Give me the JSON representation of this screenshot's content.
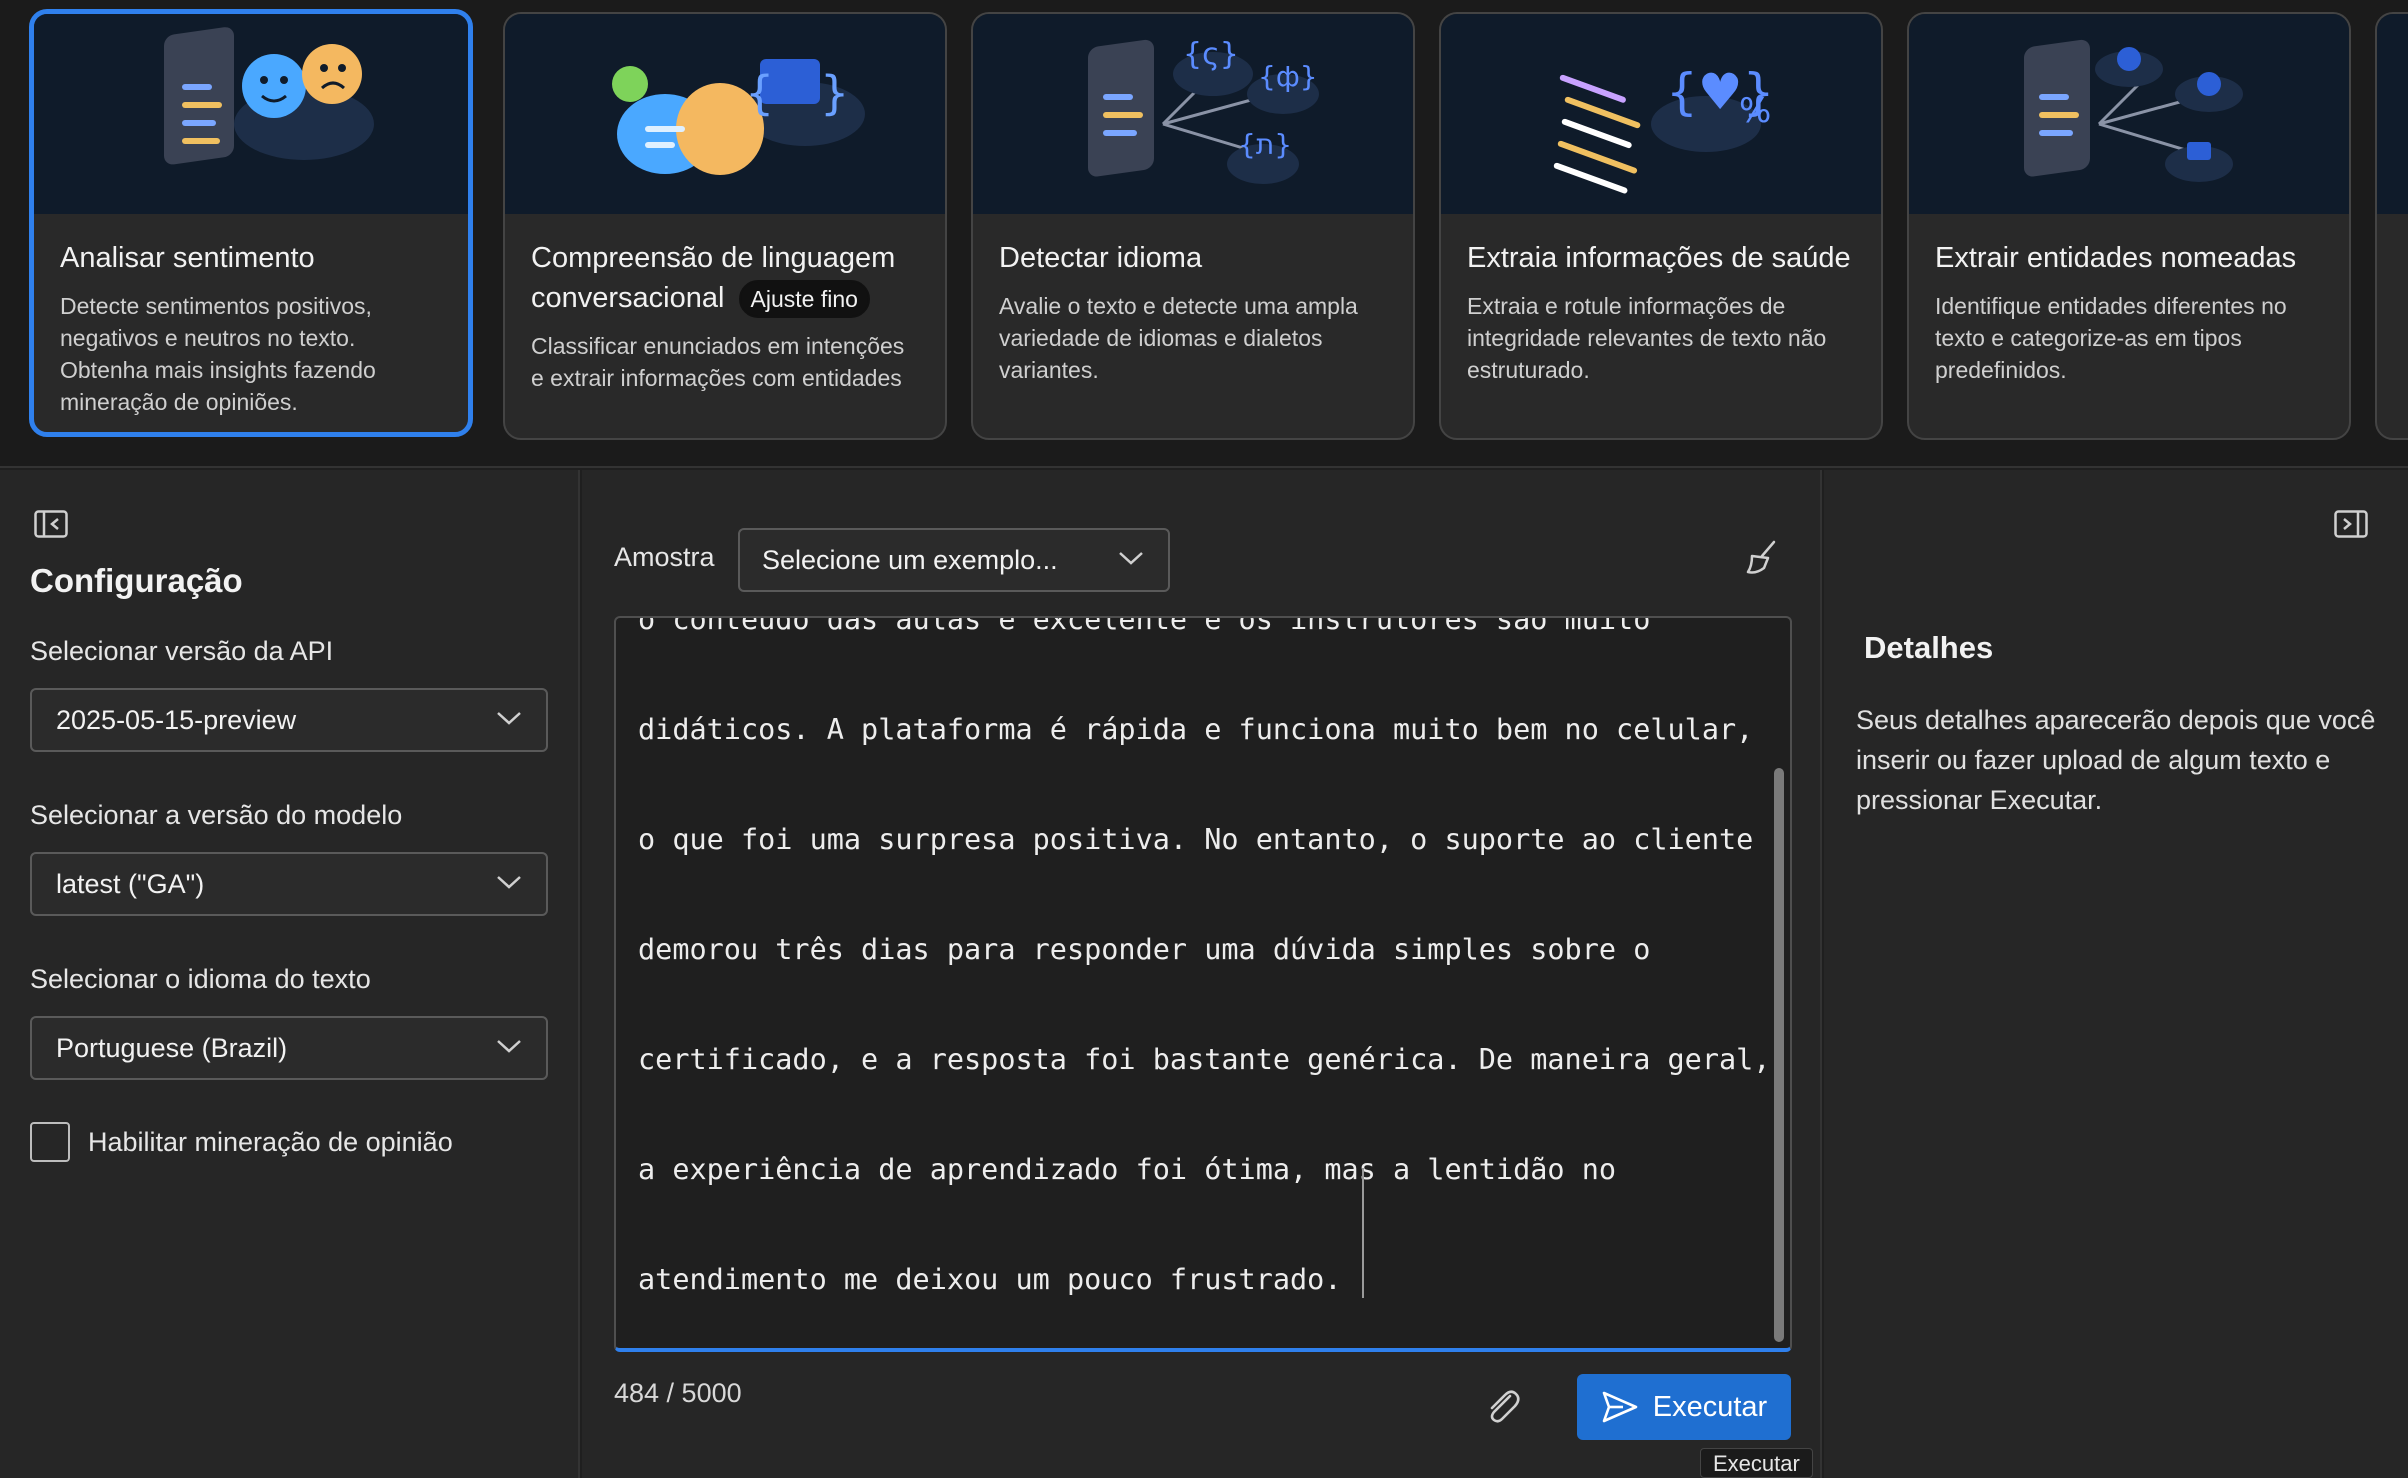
{
  "cards": [
    {
      "title": "Analisar sentimento",
      "description": "Detecte sentimentos positivos, negativos e neutros no texto. Obtenha mais insights fazendo mineração de opiniões.",
      "selected": true
    },
    {
      "title": "Compreensão de linguagem conversacional",
      "badge": "Ajuste fino",
      "description": "Classificar enunciados em intenções e extrair informações com entidades",
      "selected": false
    },
    {
      "title": "Detectar idioma",
      "description": "Avalie o texto e detecte uma ampla variedade de idiomas e dialetos variantes.",
      "selected": false
    },
    {
      "title": "Extraia informações de saúde",
      "description": "Extraia e rotule informações de integridade relevantes de texto não estruturado.",
      "selected": false
    },
    {
      "title": "Extrair entidades nomeadas",
      "description": "Identifique entidades diferentes no texto e categorize-as em tipos predefinidos.",
      "selected": false
    }
  ],
  "config": {
    "title": "Configuração",
    "api_version_label": "Selecionar versão da API",
    "api_version_value": "2025-05-15-preview",
    "model_version_label": "Selecionar a versão do modelo",
    "model_version_value": "latest (\"GA\")",
    "language_label": "Selecionar o idioma do texto",
    "language_value": "Portuguese (Brazil)",
    "opinion_mining_label": "Habilitar mineração de opinião",
    "opinion_mining_checked": false
  },
  "editor": {
    "sample_label": "Amostra",
    "sample_placeholder": "Selecione um exemplo...",
    "text_lines": [
      "o conteúdo das aulas é excelente e os instrutores são muito",
      "didáticos. A plataforma é rápida e funciona muito bem no celular,",
      "o que foi uma surpresa positiva. No entanto, o suporte ao cliente",
      "demorou três dias para responder uma dúvida simples sobre o",
      "certificado, e a resposta foi bastante genérica. De maneira geral,",
      "a experiência de aprendizado foi ótima, mas a lentidão no",
      "atendimento me deixou um pouco frustrado."
    ],
    "char_count": "484 / 5000",
    "run_label": "Executar",
    "tooltip": "Executar"
  },
  "details": {
    "title": "Detalhes",
    "text": "Seus detalhes aparecerão depois que você inserir ou fazer upload de algum texto e pressionar Executar."
  },
  "colors": {
    "accent": "#2f80ed",
    "run_button": "#1f6fd1",
    "background": "#262626"
  }
}
